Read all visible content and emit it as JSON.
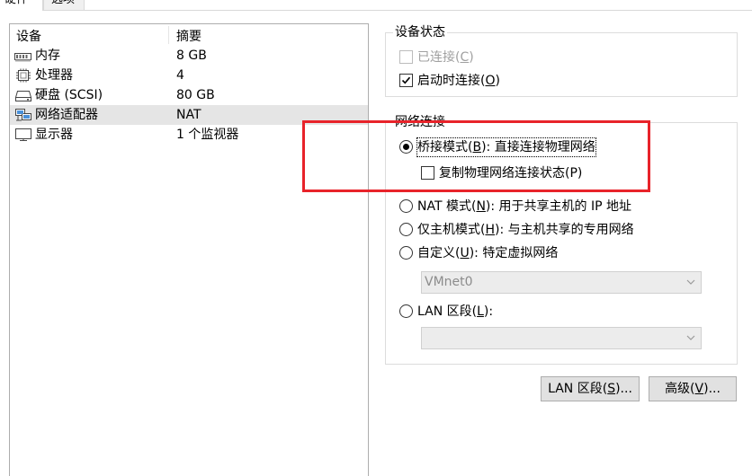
{
  "tabs": [
    {
      "label": "硬件"
    },
    {
      "label": "选项"
    }
  ],
  "device_list": {
    "headers": {
      "device": "设备",
      "summary": "摘要"
    },
    "rows": [
      {
        "icon": "memory-icon",
        "name": "内存",
        "summary": "8 GB"
      },
      {
        "icon": "cpu-icon",
        "name": "处理器",
        "summary": "4"
      },
      {
        "icon": "hard-disk-icon",
        "name": "硬盘 (SCSI)",
        "summary": "80 GB"
      },
      {
        "icon": "network-adapter-icon",
        "name": "网络适配器",
        "summary": "NAT"
      },
      {
        "icon": "display-icon",
        "name": "显示器",
        "summary": "1 个监视器"
      }
    ],
    "selected": "网络适配器"
  },
  "device_status": {
    "title": "设备状态",
    "connected": {
      "label": "已连接(",
      "key": "C",
      "tail": ")",
      "checked": false,
      "enabled": false
    },
    "connect_at_power_on": {
      "label": "启动时连接(",
      "key": "O",
      "tail": ")",
      "checked": true
    }
  },
  "network_connection": {
    "title": "网络连接",
    "bridged": {
      "label": "桥接模式(",
      "key": "B",
      "tail": "): 直接连接物理网络",
      "selected": true
    },
    "replicate": {
      "label": "复制物理网络连接状态(P)",
      "checked": false
    },
    "nat": {
      "label": "NAT 模式(",
      "key": "N",
      "tail": "): 用于共享主机的 IP 地址",
      "selected": false
    },
    "host_only": {
      "label": "仅主机模式(",
      "key": "H",
      "tail": "): 与主机共享的专用网络",
      "selected": false
    },
    "custom": {
      "label": "自定义(",
      "key": "U",
      "tail": "): 特定虚拟网络",
      "selected": false
    },
    "custom_select_value": "VMnet0",
    "lan_segment": {
      "label": "LAN 区段(",
      "key": "L",
      "tail": "):",
      "selected": false
    },
    "lan_select_value": ""
  },
  "buttons": {
    "lan_segments": {
      "label": "LAN 区段(",
      "key": "S",
      "tail": ")..."
    },
    "advanced": {
      "label": "高级(",
      "key": "V",
      "tail": ")..."
    }
  },
  "colors": {
    "highlight": "#e8232a",
    "selection": "#e5e5e5"
  }
}
